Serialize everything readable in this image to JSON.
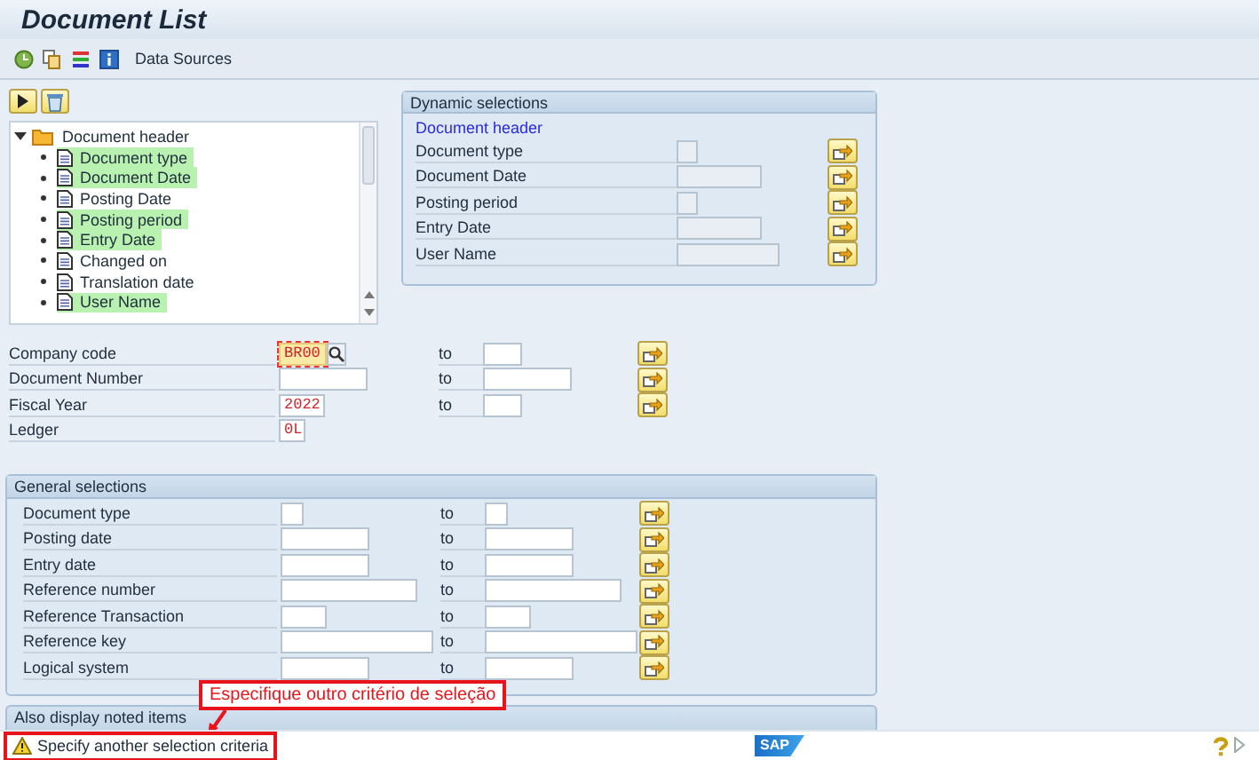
{
  "window": {
    "title": "Document List"
  },
  "toolbar": {
    "label": "Data Sources"
  },
  "tree": {
    "items": [
      {
        "label": "Document header",
        "expanded": true,
        "children": [
          {
            "label": "Document type",
            "highlighted": true
          },
          {
            "label": "Document Date",
            "highlighted": true
          },
          {
            "label": "Posting Date",
            "highlighted": false
          },
          {
            "label": "Posting period",
            "highlighted": true
          },
          {
            "label": "Entry Date",
            "highlighted": true
          },
          {
            "label": "Changed on",
            "highlighted": false
          },
          {
            "label": "Translation date",
            "highlighted": false
          },
          {
            "label": "User Name",
            "highlighted": true
          }
        ]
      }
    ]
  },
  "dynamic_selections": {
    "title": "Dynamic selections",
    "group": "Document header",
    "rows": [
      {
        "label": "Document type"
      },
      {
        "label": "Document Date"
      },
      {
        "label": "Posting period"
      },
      {
        "label": "Entry Date"
      },
      {
        "label": "User Name"
      }
    ]
  },
  "selections": [
    {
      "label": "Company code",
      "value": "BR00",
      "error": true,
      "to_label": "to"
    },
    {
      "label": "Document Number",
      "error": false,
      "to_label": "to"
    },
    {
      "label": "Fiscal Year",
      "value": "2022",
      "error": false,
      "to_label": "to"
    },
    {
      "label": "Ledger",
      "value": "0L",
      "error": false
    }
  ],
  "general_selections": {
    "title": "General selections",
    "rows": [
      {
        "label": "Document type",
        "to_label": "to"
      },
      {
        "label": "Posting date",
        "to_label": "to"
      },
      {
        "label": "Entry date",
        "to_label": "to"
      },
      {
        "label": "Reference number",
        "to_label": "to"
      },
      {
        "label": "Reference Transaction",
        "to_label": "to"
      },
      {
        "label": "Reference key",
        "to_label": "to"
      },
      {
        "label": "Logical system",
        "to_label": "to"
      }
    ]
  },
  "noted_items": {
    "title": "Also display noted items"
  },
  "annotation": {
    "text": "Especifique outro critério de seleção"
  },
  "status_bar": {
    "message": "Specify another selection criteria",
    "kind": "warning",
    "annotated": true,
    "logo": "SAP"
  }
}
